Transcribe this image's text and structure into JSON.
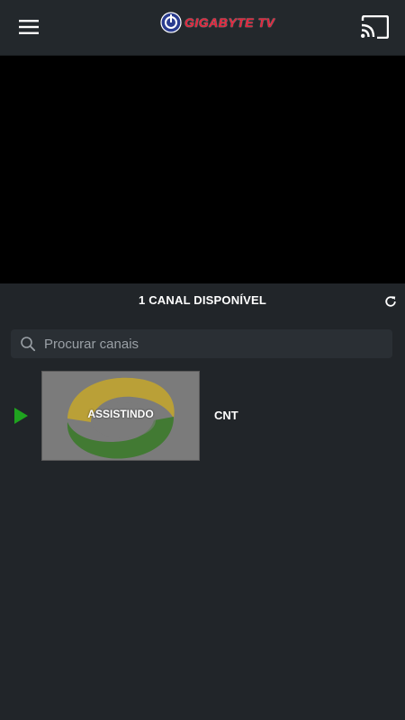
{
  "header": {
    "menu_icon": "hamburger-menu-icon",
    "logo_text": "GIGABYTE TV",
    "cast_icon": "cast-icon"
  },
  "player": {
    "state": "black"
  },
  "channels": {
    "count_text": "1 CANAL DISPONÍVEL",
    "refresh_icon": "refresh-icon",
    "search": {
      "placeholder": "Procurar canais",
      "value": ""
    },
    "list": [
      {
        "name": "CNT",
        "status": "ASSISTINDO",
        "playing": true
      }
    ]
  },
  "colors": {
    "background": "#212529",
    "topbar": "#23282c",
    "accent_play": "#1fa31f",
    "logo_red": "#e2233a",
    "logo_swirl_yellow": "#d4b21c",
    "logo_swirl_green": "#3f8a2a"
  }
}
